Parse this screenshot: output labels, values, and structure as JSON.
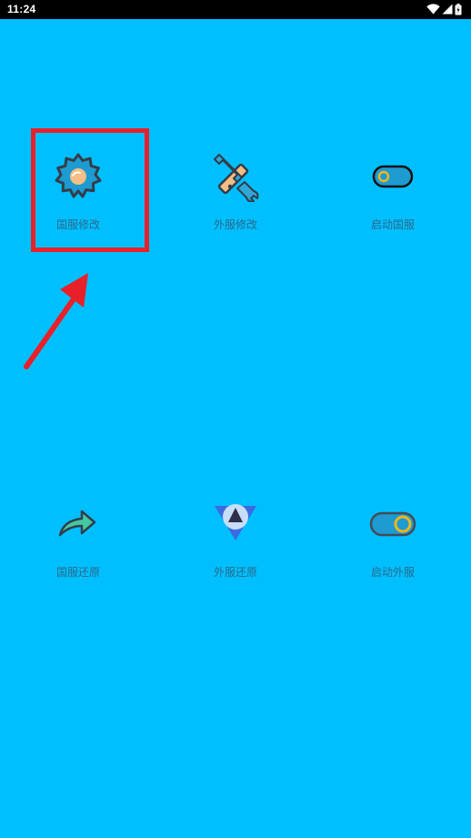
{
  "status_bar": {
    "time": "11:24"
  },
  "colors": {
    "background": "#00BFFF",
    "label": "#2a6a8a",
    "annotation": "#E8202A"
  },
  "menu": {
    "items": [
      {
        "label": "国服修改",
        "icon": "gear-icon"
      },
      {
        "label": "外服修改",
        "icon": "wrench-icon"
      },
      {
        "label": "启动国服",
        "icon": "toggle-off-icon"
      },
      {
        "label": "国服还原",
        "icon": "share-arrow-icon"
      },
      {
        "label": "外服还原",
        "icon": "triangle-badge-icon"
      },
      {
        "label": "启动外服",
        "icon": "toggle-on-icon"
      }
    ]
  }
}
